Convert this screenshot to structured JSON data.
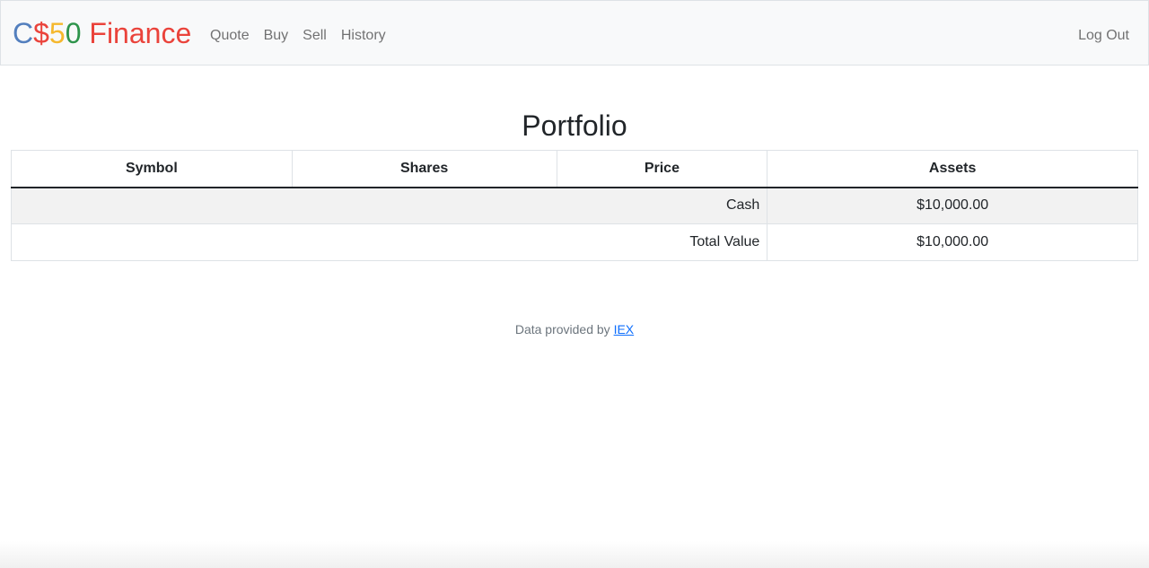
{
  "navbar": {
    "brand": {
      "part1": "C",
      "part2": "$",
      "part3": "5",
      "part4": "0",
      "part5": " Finance",
      "colors": {
        "c": "#537fbe",
        "dollar": "#ea433b",
        "five": "#f5b82e",
        "zero": "#2e944b",
        "finance": "#ea433b"
      }
    },
    "links": [
      {
        "label": "Quote"
      },
      {
        "label": "Buy"
      },
      {
        "label": "Sell"
      },
      {
        "label": "History"
      }
    ],
    "logout_label": "Log Out"
  },
  "main": {
    "title": "Portfolio",
    "table": {
      "headers": [
        "Symbol",
        "Shares",
        "Price",
        "Assets"
      ],
      "rows": [
        {
          "label": "Cash",
          "value": "$10,000.00"
        },
        {
          "label": "Total Value",
          "value": "$10,000.00"
        }
      ]
    }
  },
  "footer": {
    "text": "Data provided by ",
    "link_label": "IEX"
  }
}
